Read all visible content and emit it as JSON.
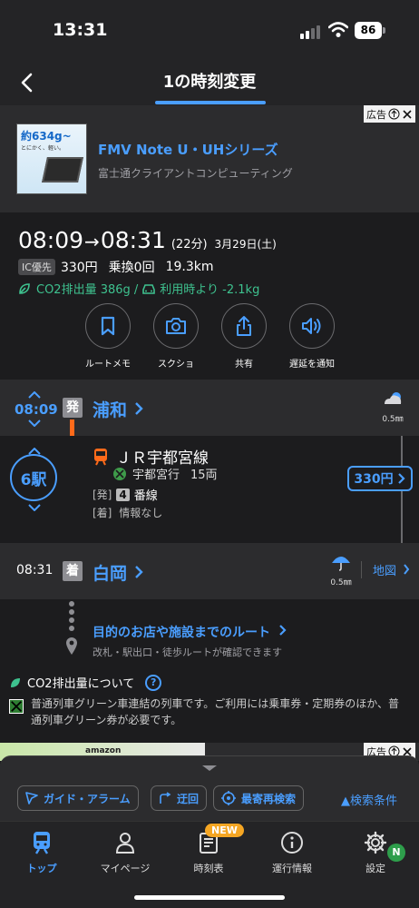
{
  "status_bar": {
    "time": "13:31",
    "battery": "86"
  },
  "header": {
    "title": "1の時刻変更"
  },
  "ad_top": {
    "badge": "広告",
    "thumb_headline": "約634g~",
    "thumb_tagline": "とにかく、軽い。",
    "title": "FMV Note U・UHシリーズ",
    "advertiser": "富士通クライアントコンピューティング"
  },
  "summary": {
    "depart": "08:09",
    "arrow": "→",
    "arrive": "08:31",
    "duration": "(22分)",
    "date": "3月29日(土)",
    "ic_label": "IC優先",
    "fare": "330円",
    "transfers": "乗換0回",
    "distance": "19.3km",
    "co2_text": "CO2排出量 386g /",
    "co2_compare": "利用時より -2.1kg"
  },
  "actions": [
    {
      "label": "ルートメモ",
      "icon": "bookmark-icon"
    },
    {
      "label": "スクショ",
      "icon": "camera-icon"
    },
    {
      "label": "共有",
      "icon": "share-icon"
    },
    {
      "label": "遅延を通知",
      "icon": "speaker-icon"
    }
  ],
  "departure": {
    "time": "08:09",
    "badge": "発",
    "station": "浦和",
    "rain": "0.5㎜"
  },
  "train": {
    "stations_count": "6駅",
    "line": "ＪＲ宇都宮線",
    "direction": "宇都宮行",
    "cars": "15両",
    "dep_label": "[発]",
    "platform": "4",
    "platform_suffix": "番線",
    "arr_label": "[着]",
    "arr_info": "情報なし",
    "fare": "330円"
  },
  "arrival": {
    "time": "08:31",
    "badge": "着",
    "station": "白岡",
    "rain": "0.5㎜",
    "map_link": "地図"
  },
  "destination": {
    "link": "目的のお店や施設までのルート",
    "sub": "改札・駅出口・徒歩ルートが確認できます"
  },
  "co2_info": {
    "title": "CO2排出量について",
    "help": "?",
    "note": "普通列車グリーン車連結の列車です。ご利用には乗車券・定期券のほか、普通列車グリーン券が必要です。"
  },
  "ad_bottom": {
    "badge": "広告",
    "brand": "amazon"
  },
  "sheet": {
    "guide": "ガイド・アラーム",
    "detour": "迂回",
    "research": "最寄再検索",
    "conditions": "▲検索条件"
  },
  "tabs": [
    {
      "label": "トップ",
      "icon": "train-icon",
      "active": true
    },
    {
      "label": "マイページ",
      "icon": "person-icon"
    },
    {
      "label": "時刻表",
      "icon": "timetable-icon",
      "badge": "NEW"
    },
    {
      "label": "運行情報",
      "icon": "info-icon"
    },
    {
      "label": "設定",
      "icon": "gear-icon",
      "badge": "N"
    }
  ],
  "colors": {
    "accent": "#4a9eff",
    "route": "#ff6a1a",
    "eco": "#3ec28f",
    "background": "#1c1c1e"
  }
}
